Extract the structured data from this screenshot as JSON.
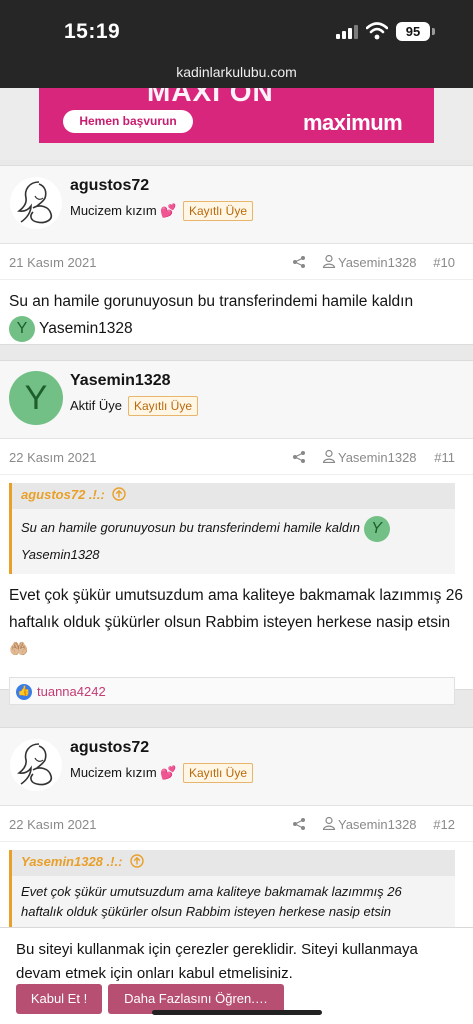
{
  "status": {
    "time": "15:19",
    "battery": "95"
  },
  "browser": {
    "url": "kadinlarkulubu.com"
  },
  "ad": {
    "title": "MAXI ON",
    "button": "Hemen başvurun",
    "brand": "maximum"
  },
  "posts": [
    {
      "username": "agustos72",
      "title": "Mucizem kızım 💕",
      "badge": "Kayıtlı Üye",
      "date": "21 Kasım 2021",
      "quote_user": "Yasemin1328",
      "number": "#10",
      "text": "Su an hamile gorunuyosun bu transferindemi hamile kaldın",
      "mention_letter": "Y",
      "mention": "Yasemin1328"
    },
    {
      "username": "Yasemin1328",
      "avatar_letter": "Y",
      "title": "Aktif Üye",
      "badge": "Kayıtlı Üye",
      "date": "22 Kasım 2021",
      "quote_user": "Yasemin1328",
      "number": "#11",
      "quote_header": "agustos72 .!.:",
      "quote_text": "Su an hamile gorunuyosun bu transferindemi hamile kaldın",
      "quote_mention_letter": "Y",
      "quote_mention": "Yasemin1328",
      "text": "Evet çok şükür umutsuzdum ama kaliteye bakmamak lazımmış 26 haftalık olduk şükürler olsun Rabbim isteyen herkese nasip etsin🤲🏼",
      "reaction_user": "tuanna4242"
    },
    {
      "username": "agustos72",
      "title": "Mucizem kızım 💕",
      "badge": "Kayıtlı Üye",
      "date": "22 Kasım 2021",
      "quote_user": "Yasemin1328",
      "number": "#12",
      "quote_header": "Yasemin1328 .!.:",
      "quote_text": "Evet çok şükür umutsuzdum ama kaliteye bakmamak lazımmış 26 haftalık olduk şükürler olsun Rabbim isteyen herkese nasip etsin"
    }
  ],
  "cookie": {
    "text": "Bu siteyi kullanmak için çerezler gereklidir. Siteyi kullanmaya devam etmek için onları kabul etmelisiniz.",
    "accept": "Kabul Et !",
    "learn_more": "Daha Fazlasını Öğren.…"
  }
}
